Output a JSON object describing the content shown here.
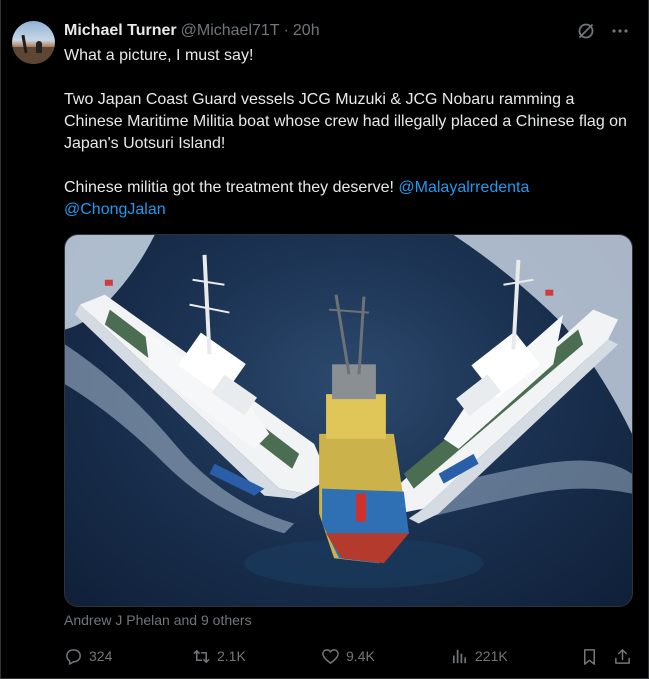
{
  "tweet": {
    "author_name": "Michael Turner",
    "author_handle": "@Michael71T",
    "separator": "·",
    "time": "20h",
    "text_para1": "What a picture, I must say!",
    "text_para2": "Two Japan Coast Guard vessels JCG Muzuki  & JCG Nobaru ramming a Chinese Maritime Militia boat whose crew had illegally placed a Chinese flag on Japan's Uotsuri Island!",
    "text_para3": "Chinese militia got the treatment they deserve!",
    "mention1": "@Malayalrredenta",
    "mention2": "@ChongJalan",
    "likers": "Andrew J Phelan and 9 others"
  },
  "actions": {
    "replies": "324",
    "reposts": "2.1K",
    "likes": "9.4K",
    "views": "221K"
  },
  "icons": {
    "grok": "grok-slash-icon",
    "more": "more-dots-icon",
    "reply": "reply-icon",
    "repost": "repost-icon",
    "like": "heart-icon",
    "views": "views-icon",
    "bookmark": "bookmark-icon",
    "share": "share-icon"
  },
  "colors": {
    "background": "#000000",
    "text": "#e7e9ea",
    "muted": "#71767b",
    "link": "#1d9bf0"
  }
}
